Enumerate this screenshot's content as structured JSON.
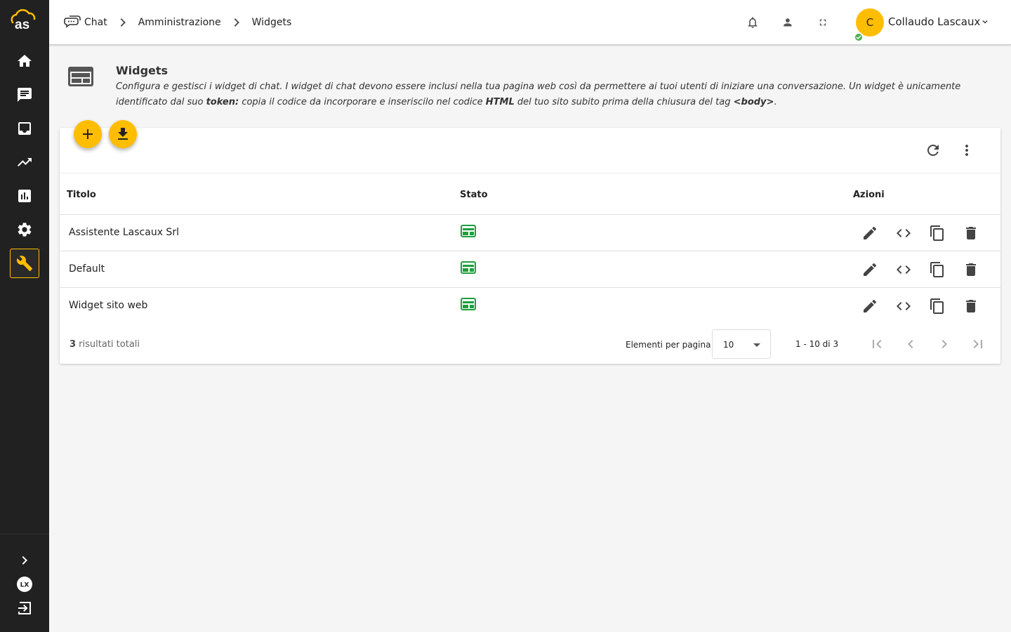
{
  "brand": {
    "logo_text": "as"
  },
  "sidebar": {
    "items": [
      {
        "icon": "home-icon"
      },
      {
        "icon": "chat-icon"
      },
      {
        "icon": "inbox-icon"
      },
      {
        "icon": "trending-icon"
      },
      {
        "icon": "bar-chart-icon"
      },
      {
        "icon": "settings-icon"
      },
      {
        "icon": "wrench-icon",
        "active": true
      }
    ],
    "bottom": [
      {
        "icon": "expand-icon"
      },
      {
        "icon": "lx-logo-icon",
        "text": "LX"
      },
      {
        "icon": "logout-icon"
      }
    ]
  },
  "breadcrumb": [
    "Chat",
    "Amministrazione",
    "Widgets"
  ],
  "user": {
    "initial": "C",
    "name": "Collaudo Lascaux"
  },
  "header": {
    "title": "Widgets",
    "desc_1": "Configura e gestisci i widget di chat. I widget di chat devono essere inclusi nella tua pagina web così da permettere ai tuoi utenti di iniziare una conversazione. Un widget è unicamente identificato dal suo ",
    "desc_token": "token:",
    "desc_2": " copia il codice da incorporare e inseriscilo nel codice ",
    "desc_html": "HTML",
    "desc_3": " del tuo sito subito prima della chiusura del tag ",
    "desc_body": "<body>",
    "desc_4": "."
  },
  "table": {
    "columns": [
      "Titolo",
      "Stato",
      "Azioni"
    ],
    "rows": [
      {
        "title": "Assistente Lascaux Srl"
      },
      {
        "title": "Default"
      },
      {
        "title": "Widget sito web"
      }
    ]
  },
  "footer": {
    "total_count": "3",
    "total_label": " risultati totali",
    "per_page_label": "Elementi per pagina",
    "per_page_value": "10",
    "range": "1 - 10 di 3"
  },
  "colors": {
    "accent": "#ffbd00",
    "sidebar": "#212121",
    "status_active": "#1e9e3e",
    "online": "#4caf50"
  }
}
